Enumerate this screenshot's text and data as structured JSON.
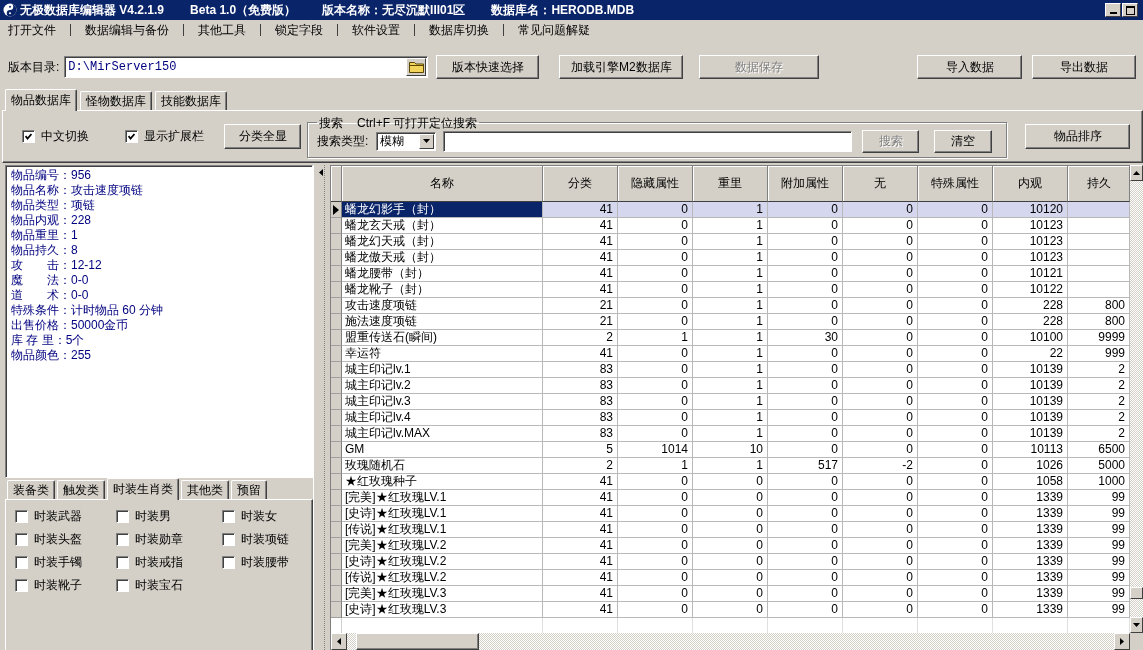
{
  "window": {
    "title_parts": [
      "无极数据库编辑器 V4.2.1.9",
      "Beta 1.0（免费版）",
      "版本名称：无尽沉默III01区",
      "数据库名：HERODB.MDB"
    ]
  },
  "menu": [
    "打开文件",
    "数据编辑与备份",
    "其他工具",
    "锁定字段",
    "软件设置",
    "数据库切换",
    "常见问题解疑"
  ],
  "toolbar": {
    "directory_label": "版本目录:",
    "directory_value": "D:\\MirServer150",
    "buttons": [
      {
        "label": "版本快速选择",
        "disabled": false
      },
      {
        "label": "加载引擎M2数据库",
        "disabled": false
      },
      {
        "label": "数据保存",
        "disabled": true
      }
    ],
    "data_buttons": [
      {
        "label": "导入数据",
        "disabled": false
      },
      {
        "label": "导出数据",
        "disabled": false
      }
    ]
  },
  "tabs": [
    {
      "label": "物品数据库",
      "selected": true
    },
    {
      "label": "怪物数据库",
      "selected": false
    },
    {
      "label": "技能数据库",
      "selected": false
    }
  ],
  "options": {
    "checkboxes": [
      {
        "label": "中文切换",
        "checked": true
      },
      {
        "label": "显示扩展栏",
        "checked": true
      }
    ],
    "show_all_button": "分类全显"
  },
  "search": {
    "legend": "搜索",
    "hint": "Ctrl+F 可打开定位搜索",
    "type_label": "搜索类型:",
    "type_value": "模糊",
    "search_button": {
      "label": "搜索",
      "disabled": true
    },
    "clear_button": {
      "label": "清空",
      "disabled": false
    }
  },
  "sort_button": "物品排序",
  "item_info": [
    "物品编号：956",
    "物品名称：攻击速度项链",
    "物品类型：项链",
    "物品内观：228",
    "物品重里：1",
    "物品持久：8",
    "攻　　击：12-12",
    "魔　　法：0-0",
    "道　　术：0-0",
    "特殊条件：计时物品 60 分钟",
    "出售价格：50000金币",
    "库 存 里：5个",
    "物品颜色：255"
  ],
  "category_tabs": [
    {
      "label": "装备类",
      "selected": false
    },
    {
      "label": "触发类",
      "selected": false
    },
    {
      "label": "时装生肖类",
      "selected": true
    },
    {
      "label": "其他类",
      "selected": false
    },
    {
      "label": "预留",
      "selected": false
    }
  ],
  "category_checkboxes": [
    {
      "label": "时装武器",
      "checked": false
    },
    {
      "label": "时装男",
      "checked": false
    },
    {
      "label": "时装女",
      "checked": false
    },
    {
      "label": "时装头盔",
      "checked": false
    },
    {
      "label": "时装勋章",
      "checked": false
    },
    {
      "label": "时装项链",
      "checked": false
    },
    {
      "label": "时装手镯",
      "checked": false
    },
    {
      "label": "时装戒指",
      "checked": false
    },
    {
      "label": "时装腰带",
      "checked": false
    },
    {
      "label": "时装靴子",
      "checked": false
    },
    {
      "label": "时装宝石",
      "checked": false
    }
  ],
  "table": {
    "columns": [
      "名称",
      "分类",
      "隐藏属性",
      "重里",
      "附加属性",
      "无",
      "特殊属性",
      "内观",
      "持久"
    ],
    "rows": [
      {
        "selected": true,
        "cells": [
          "蟠龙幻影手（封）",
          "41",
          "0",
          "1",
          "0",
          "0",
          "0",
          "10120"
        ]
      },
      {
        "selected": false,
        "cells": [
          "蟠龙玄天戒（封）",
          "41",
          "0",
          "1",
          "0",
          "0",
          "0",
          "10123"
        ]
      },
      {
        "selected": false,
        "cells": [
          "蟠龙幻天戒（封）",
          "41",
          "0",
          "1",
          "0",
          "0",
          "0",
          "10123"
        ]
      },
      {
        "selected": false,
        "cells": [
          "蟠龙傲天戒（封）",
          "41",
          "0",
          "1",
          "0",
          "0",
          "0",
          "10123"
        ]
      },
      {
        "selected": false,
        "cells": [
          "蟠龙腰带（封）",
          "41",
          "0",
          "1",
          "0",
          "0",
          "0",
          "10121"
        ]
      },
      {
        "selected": false,
        "cells": [
          "蟠龙靴子（封）",
          "41",
          "0",
          "1",
          "0",
          "0",
          "0",
          "10122"
        ]
      },
      {
        "selected": false,
        "cells": [
          "攻击速度项链",
          "21",
          "0",
          "1",
          "0",
          "0",
          "0",
          "228",
          "800"
        ]
      },
      {
        "selected": false,
        "cells": [
          "施法速度项链",
          "21",
          "0",
          "1",
          "0",
          "0",
          "0",
          "228",
          "800"
        ]
      },
      {
        "selected": false,
        "cells": [
          "盟重传送石(瞬间)",
          "2",
          "1",
          "1",
          "30",
          "0",
          "0",
          "10100",
          "9999"
        ]
      },
      {
        "selected": false,
        "cells": [
          "幸运符",
          "41",
          "0",
          "1",
          "0",
          "0",
          "0",
          "22",
          "999"
        ]
      },
      {
        "selected": false,
        "cells": [
          "城主印记lv.1",
          "83",
          "0",
          "1",
          "0",
          "0",
          "0",
          "10139",
          "2"
        ]
      },
      {
        "selected": false,
        "cells": [
          "城主印记lv.2",
          "83",
          "0",
          "1",
          "0",
          "0",
          "0",
          "10139",
          "2"
        ]
      },
      {
        "selected": false,
        "cells": [
          "城主印记lv.3",
          "83",
          "0",
          "1",
          "0",
          "0",
          "0",
          "10139",
          "2"
        ]
      },
      {
        "selected": false,
        "cells": [
          "城主印记lv.4",
          "83",
          "0",
          "1",
          "0",
          "0",
          "0",
          "10139",
          "2"
        ]
      },
      {
        "selected": false,
        "cells": [
          "城主印记lv.MAX",
          "83",
          "0",
          "1",
          "0",
          "0",
          "0",
          "10139",
          "2"
        ]
      },
      {
        "selected": false,
        "cells": [
          "GM",
          "5",
          "1014",
          "10",
          "0",
          "0",
          "0",
          "10113",
          "6500"
        ]
      },
      {
        "selected": false,
        "cells": [
          "玫瑰随机石",
          "2",
          "1",
          "1",
          "517",
          "-2",
          "0",
          "1026",
          "5000"
        ]
      },
      {
        "selected": false,
        "cells": [
          "★红玫瑰种子",
          "41",
          "0",
          "0",
          "0",
          "0",
          "0",
          "1058",
          "1000"
        ]
      },
      {
        "selected": false,
        "cells": [
          "[完美]★红玫瑰LV.1",
          "41",
          "0",
          "0",
          "0",
          "0",
          "0",
          "1339",
          "99"
        ]
      },
      {
        "selected": false,
        "cells": [
          "[史诗]★红玫瑰LV.1",
          "41",
          "0",
          "0",
          "0",
          "0",
          "0",
          "1339",
          "99"
        ]
      },
      {
        "selected": false,
        "cells": [
          "[传说]★红玫瑰LV.1",
          "41",
          "0",
          "0",
          "0",
          "0",
          "0",
          "1339",
          "99"
        ]
      },
      {
        "selected": false,
        "cells": [
          "[完美]★红玫瑰LV.2",
          "41",
          "0",
          "0",
          "0",
          "0",
          "0",
          "1339",
          "99"
        ]
      },
      {
        "selected": false,
        "cells": [
          "[史诗]★红玫瑰LV.2",
          "41",
          "0",
          "0",
          "0",
          "0",
          "0",
          "1339",
          "99"
        ]
      },
      {
        "selected": false,
        "cells": [
          "[传说]★红玫瑰LV.2",
          "41",
          "0",
          "0",
          "0",
          "0",
          "0",
          "1339",
          "99"
        ]
      },
      {
        "selected": false,
        "cells": [
          "[完美]★红玫瑰LV.3",
          "41",
          "0",
          "0",
          "0",
          "0",
          "0",
          "1339",
          "99"
        ]
      },
      {
        "selected": false,
        "cells": [
          "[史诗]★红玫瑰LV.3",
          "41",
          "0",
          "0",
          "0",
          "0",
          "0",
          "1339",
          "99"
        ]
      }
    ]
  }
}
